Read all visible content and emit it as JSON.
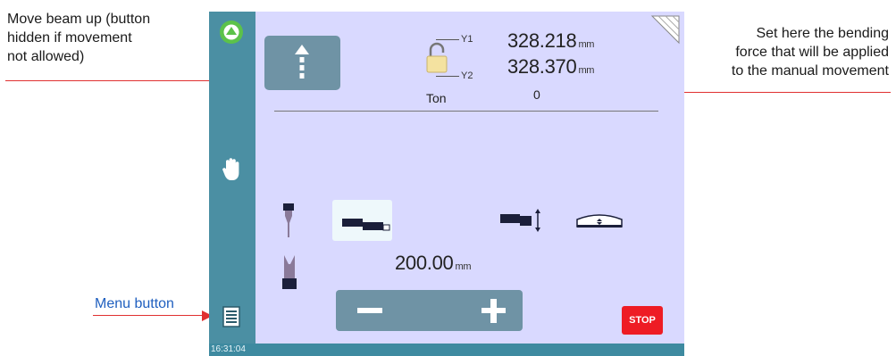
{
  "annotations": {
    "move_beam": [
      "Move beam up (button",
      "hidden if movement",
      "not allowed)"
    ],
    "bending_force": [
      "Set here the bending",
      "force that will be applied",
      "to the manual movement"
    ],
    "menu": "Menu button"
  },
  "axes": {
    "y1_label": "Y1",
    "y2_label": "Y2",
    "y1_value": "328.218",
    "y2_value": "328.370",
    "unit": "mm"
  },
  "ton": {
    "label": "Ton",
    "value": "0"
  },
  "distance": {
    "value": "200.00",
    "unit": "mm"
  },
  "stop_label": "STOP",
  "clock": "16:31:04",
  "colors": {
    "screen_bg": "#d9d9ff",
    "sidebar": "#4b8fa3",
    "button": "#6f93a5",
    "stop": "#ee1c24",
    "annotation_arrow": "#e03030",
    "menu_annotation": "#1f5fbf"
  },
  "icons": {
    "status": "green-circle-up-icon",
    "move_up": "arrow-up-dashed-icon",
    "lock": "padlock-icon",
    "corner": "corner-fold-icon",
    "manual": "hand-icon",
    "punch": "punch-tool-icon",
    "die": "die-tool-icon",
    "tool_selected": "backgauge-block-icon",
    "tool_vertical": "block-vertical-arrow-icon",
    "tool_level": "level-icon",
    "menu": "menu-list-icon",
    "minus": "minus-icon",
    "plus": "plus-icon"
  }
}
